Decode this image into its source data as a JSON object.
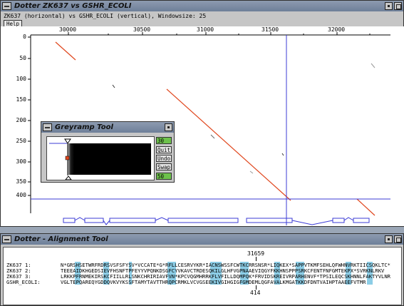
{
  "main_window": {
    "title": "Dotter ZK637 vs GSHR_ECOLI",
    "info": "ZK637 (horizontal) vs GSHR_ECOLI (vertical), Windowsize: 25",
    "help_label": "Help",
    "x_ticks": [
      "30000",
      "30500",
      "31000",
      "31500",
      "32000"
    ],
    "y_ticks": [
      "0",
      "50",
      "100",
      "150",
      "200",
      "250",
      "300",
      "350",
      "400"
    ],
    "crosshair": {
      "x_seq_pos": 31659,
      "y_seq_pos": 414
    }
  },
  "greyramp": {
    "title": "Greyramp Tool",
    "top_value": "30",
    "bottom_value": "50",
    "buttons": [
      "Quit",
      "Undo",
      "Swap"
    ]
  },
  "alignment": {
    "title": "Dotter - Alignment Tool",
    "top_coord": "31659",
    "bottom_coord": "414",
    "rows": [
      {
        "label": "ZK637 1:",
        "seq": "N*GRSHSETWRFRDRSVSFSFYSV*VCCATE*G*RFLLCESRVYKR*IACNSWSSFCWTKCRRSNSR*LIQKEX*SAPPVTKMFSEHLQFWHNVRKTIICSQKLTC*"
      },
      {
        "label": "ZK637 2:",
        "seq": "TEEEAIDKHGEDSIEVFHSNFTPFEYYVPQNKDSGFCYVKAVCTRDESQKILGLHFVGPNAAEVIQGYFKKHNSPPPSRKCFENTFNFGMTEKPX*SVRKNLRKV"
      },
      {
        "label": "ZK637 3:",
        "seq": "LRKKPFRNMEKIRSKCFIILLRLSNKCHRIRIAVFVN*KPCVQGMHRRKFLVFILLDQMPQK*FRVIDSKREIVRPARHENVF*TPSILEQCSKHNNLFAKTYVLNR"
      },
      {
        "label": "GSHR_ECOLI:",
        "seq": "VGLTEPQARЕQYGDDQVKVYKSSFTAMYTAVTTHRQPCRMKLVCVGSEEKIVGIHGIGFGMDEMLQGFAVALKMGATKKDFDNTVAIHPTAAEEFVTMR"
      }
    ]
  }
}
